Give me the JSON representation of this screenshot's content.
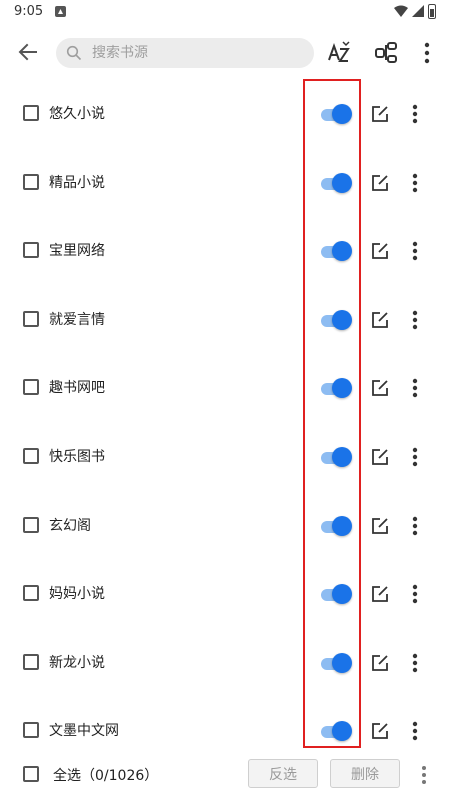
{
  "status_bar": {
    "time": "9:05"
  },
  "toolbar": {
    "search_placeholder": "搜索书源",
    "icons": [
      "back-arrow-icon",
      "search-icon",
      "sort-az-icon",
      "group-icon",
      "more-vert-icon"
    ]
  },
  "sources": [
    {
      "name": "悠久小说",
      "enabled": true,
      "checked": false
    },
    {
      "name": "精品小说",
      "enabled": true,
      "checked": false
    },
    {
      "name": "宝里网络",
      "enabled": true,
      "checked": false
    },
    {
      "name": "就爱言情",
      "enabled": true,
      "checked": false
    },
    {
      "name": "趣书网吧",
      "enabled": true,
      "checked": false
    },
    {
      "name": "快乐图书",
      "enabled": true,
      "checked": false
    },
    {
      "name": "玄幻阁",
      "enabled": true,
      "checked": false
    },
    {
      "name": "妈妈小说",
      "enabled": true,
      "checked": false
    },
    {
      "name": "新龙小说",
      "enabled": true,
      "checked": false
    },
    {
      "name": "文墨中文网",
      "enabled": true,
      "checked": false
    }
  ],
  "bottom": {
    "select_all_label": "全选（0/1026）",
    "invert_label": "反选",
    "delete_label": "删除"
  },
  "colors": {
    "accent": "#1a73e8",
    "switch_track": "#8dbcf2",
    "highlight": "#e02020"
  }
}
